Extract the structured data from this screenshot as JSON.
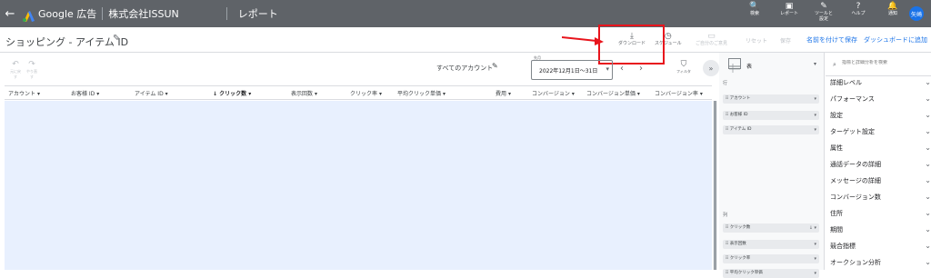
{
  "topbar": {
    "back_icon": "←",
    "brand": "Google 広告",
    "account": "株式会社ISSUN",
    "report_title": "レポート",
    "tools": [
      {
        "icon": "search-icon",
        "glyph": "🔍",
        "label": "検索"
      },
      {
        "icon": "reports-icon",
        "glyph": "▣",
        "label": "レポート"
      },
      {
        "icon": "tools-icon",
        "glyph": "✎",
        "label": "ツールと\n設定"
      },
      {
        "icon": "help-icon",
        "glyph": "?",
        "label": "ヘルプ"
      },
      {
        "icon": "bell-icon",
        "glyph": "🔔",
        "label": "通知"
      }
    ],
    "avatar": "矢崎",
    "brand_color": "#5f6368"
  },
  "header": {
    "page_title": "ショッピング - アイテム ID",
    "edit_icon": "✎",
    "download": {
      "glyph": "⤓",
      "label": "ダウンロード"
    },
    "schedule": {
      "glyph": "◷",
      "label": "スケジュール"
    },
    "share": {
      "glyph": "▭",
      "label": "ご自分のご意見"
    },
    "reset": "リセット",
    "save": "保存",
    "save_as": "名前を付けて保存",
    "add_dashboard": "ダッシュボードに追加",
    "highlight_color": "#e8141c"
  },
  "toolbar": {
    "undo": {
      "glyph": "↶",
      "label": "元に戻す"
    },
    "redo": {
      "glyph": "↷",
      "label": "やり直す"
    },
    "all_accounts": "すべてのアカウント",
    "date_caption": "先月",
    "date_value": "2022年12月1日～31日",
    "prev": "‹",
    "next": "›",
    "filter": {
      "glyph": "⛉",
      "label": "フィルタ"
    },
    "expand": "»"
  },
  "table": {
    "columns": [
      {
        "label": "アカウント",
        "caret": "▾"
      },
      {
        "label": "お客様 ID",
        "caret": "▾"
      },
      {
        "label": "アイテム ID",
        "caret": "▾"
      },
      {
        "label": "↓ クリック数",
        "caret": "▾"
      },
      {
        "label": "表示回数",
        "caret": "▾"
      },
      {
        "label": "クリック率",
        "caret": "▾"
      },
      {
        "label": "平均クリック単価",
        "caret": "▾"
      },
      {
        "label": "費用",
        "caret": "▾"
      },
      {
        "label": "コンバージョン",
        "caret": "▾"
      },
      {
        "label": "コンバージョン単価",
        "caret": "▾"
      },
      {
        "label": "コンバージョン率",
        "caret": "▾"
      }
    ]
  },
  "config": {
    "type_label": "表",
    "rows_label": "行",
    "row_chips": [
      "アカウント",
      "お客様 ID",
      "アイテム ID"
    ],
    "cols_label": "列",
    "col_chips": [
      "クリック数",
      "表示回数",
      "クリック率",
      "平均クリック単価"
    ],
    "sort_glyph": "↓"
  },
  "side": {
    "search_placeholder": "指標と詳細分析を検索",
    "categories": [
      "詳細レベル",
      "パフォーマンス",
      "設定",
      "ターゲット設定",
      "属性",
      "通話データの詳細",
      "メッセージの詳細",
      "コンバージョン数",
      "住所",
      "期間",
      "競合指標",
      "オークション分析"
    ]
  }
}
